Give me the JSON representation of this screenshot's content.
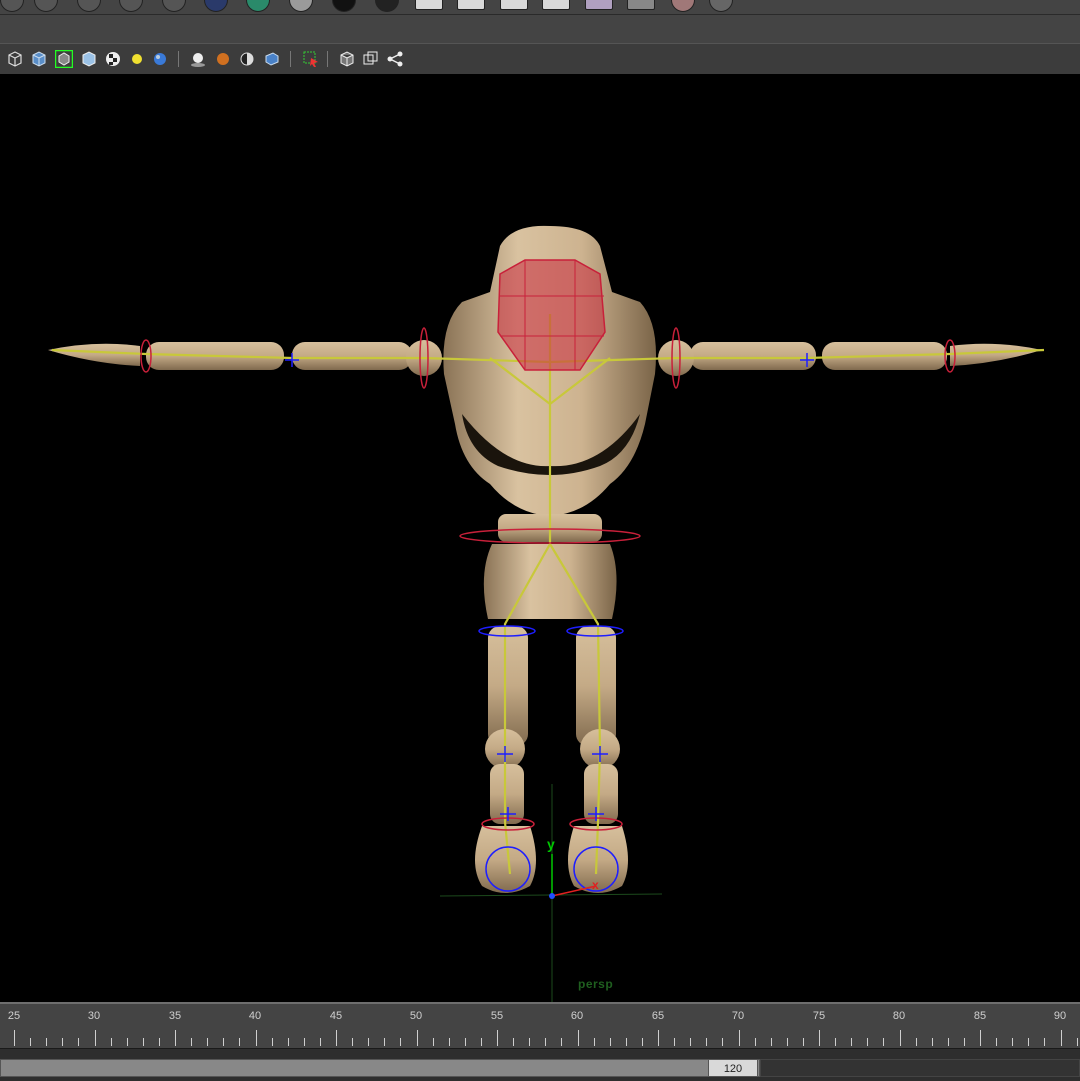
{
  "viewport": {
    "camera_label": "persp",
    "axis_y_label": "y",
    "axis_x_label": "x"
  },
  "panel_toolbar": {
    "icons": [
      "wireframe-cube-icon",
      "smooth-shade-cube-icon",
      "wireframe-on-shaded-icon",
      "xray-cube-icon",
      "checker-texture-icon",
      "light-bulb-icon",
      "blue-sphere-icon",
      "shadow-sphere-icon",
      "orange-sphere-icon",
      "half-sphere-icon",
      "blue-cube-icon",
      "select-camera-icon",
      "isolate-cube-icon",
      "overlapping-cubes-icon",
      "share-node-icon"
    ]
  },
  "time_slider": {
    "ticks": [
      "25",
      "30",
      "35",
      "40",
      "45",
      "50",
      "55",
      "60",
      "65",
      "70",
      "75",
      "80",
      "85",
      "90"
    ]
  },
  "range_slider": {
    "end_value": "120"
  },
  "colors": {
    "panel_bg": "#444444",
    "viewport_bg": "#000000",
    "model_skin": "#c8ad8c",
    "skeleton": "#c8c83a",
    "control_red": "#c8203a",
    "locator_blue": "#1e1eff"
  }
}
